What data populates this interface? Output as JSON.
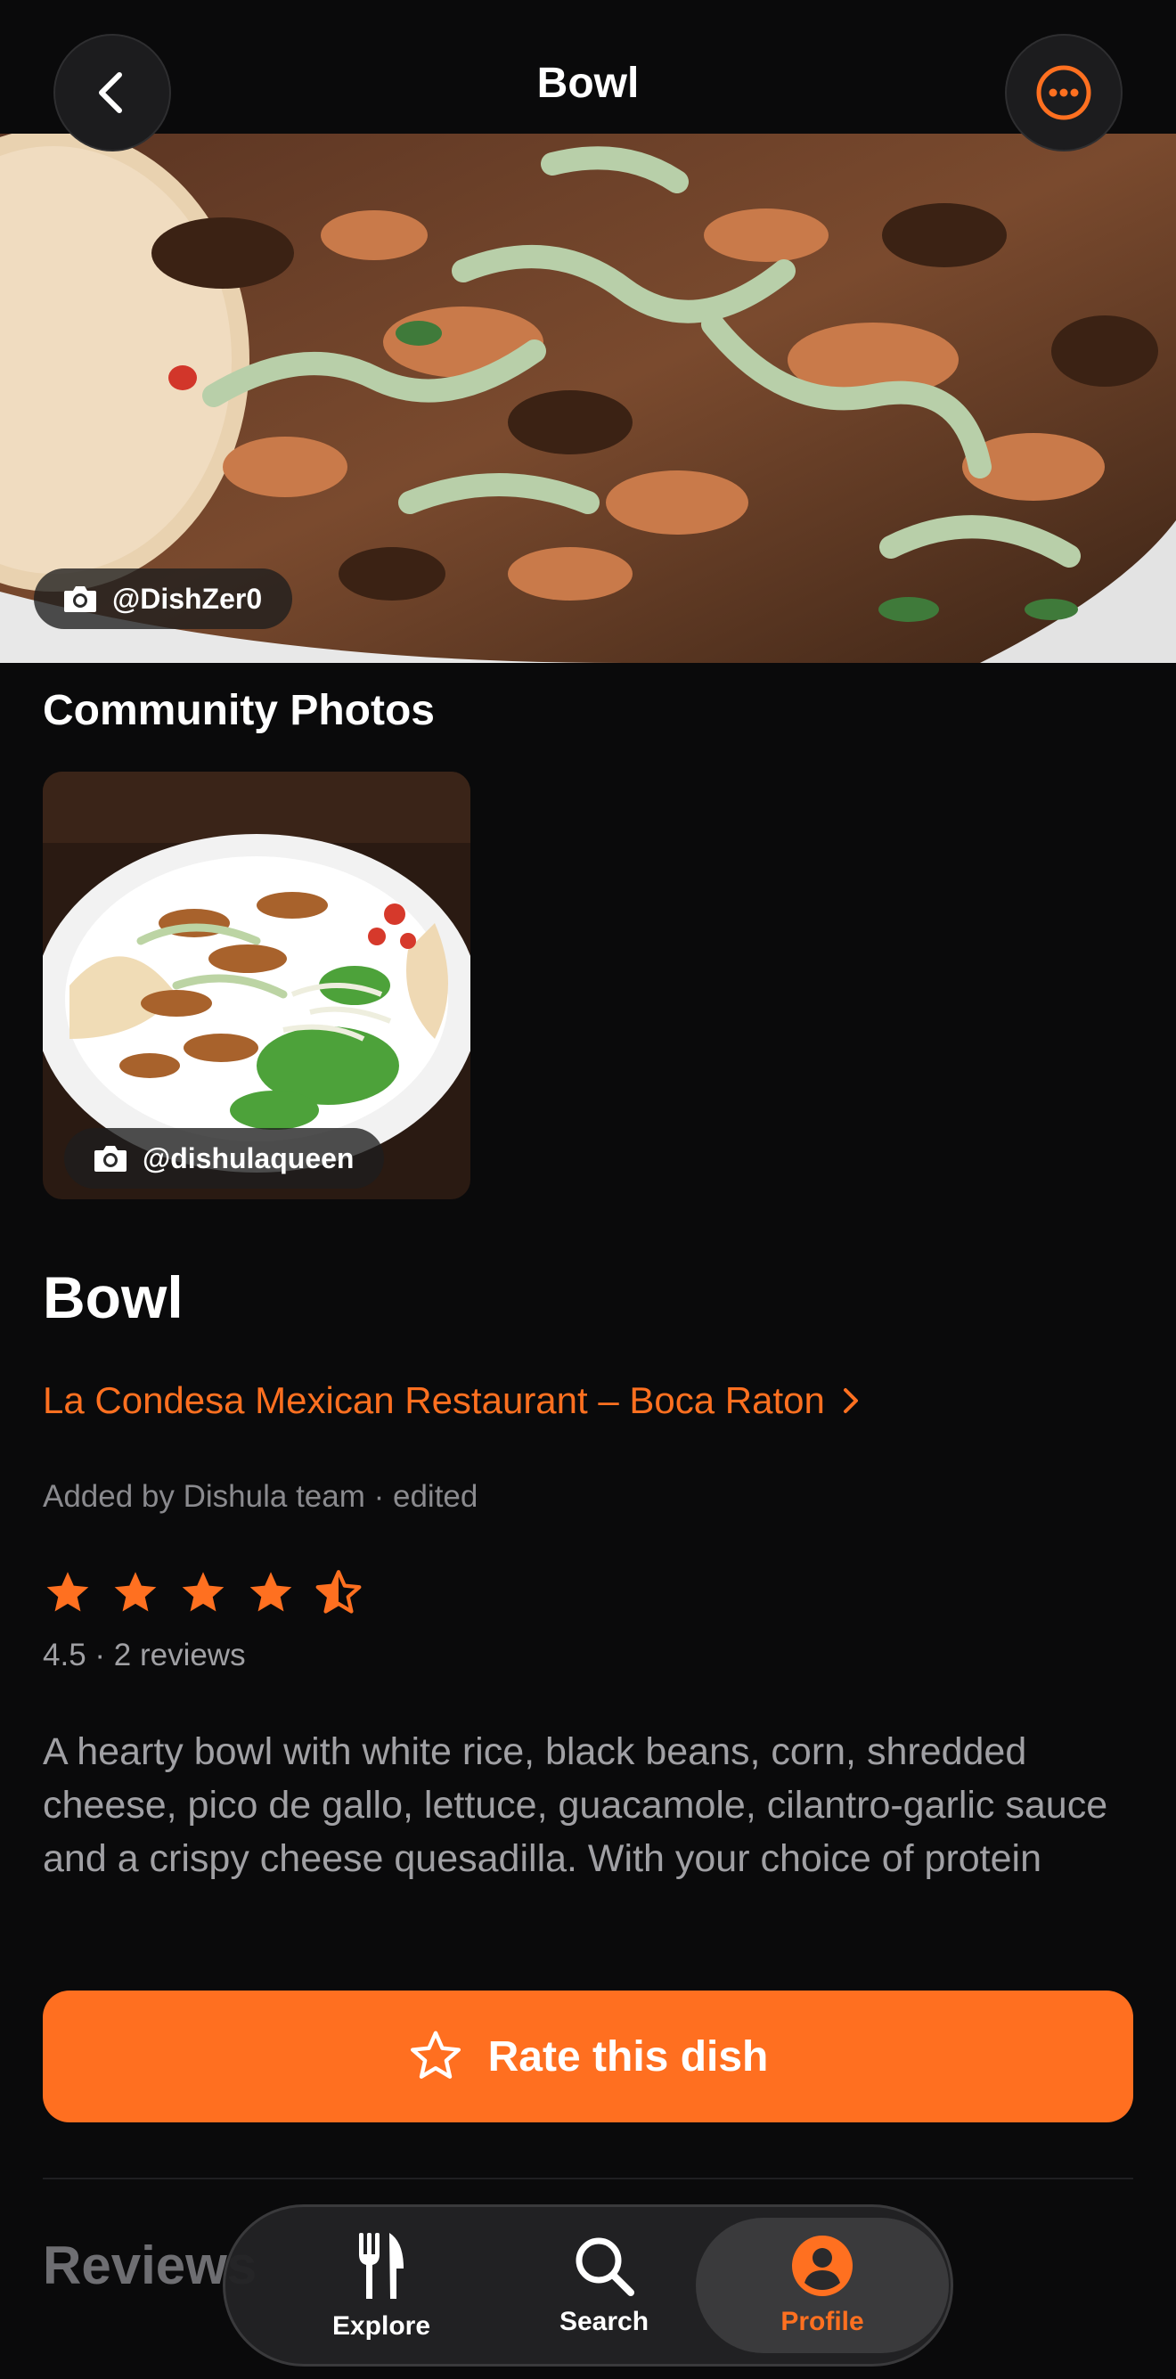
{
  "header": {
    "title": "Bowl",
    "back_icon": "chevron-left-icon",
    "more_icon": "ellipsis-circle-icon"
  },
  "hero_photo": {
    "credit": "@DishZer0"
  },
  "community": {
    "heading": "Community Photos",
    "photos": [
      {
        "credit": "@dishulaqueen"
      }
    ]
  },
  "dish": {
    "name": "Bowl",
    "restaurant": "La Condesa Mexican Restaurant – Boca Raton",
    "added_by": "Added by Dishula team · edited",
    "rating": 4.5,
    "rating_text": "4.5 · 2 reviews",
    "description": "A hearty bowl with white rice, black beans, corn, shredded cheese, pico de gallo, lettuce, guacamole, cilantro-garlic sauce and a crispy cheese quesadilla. With your choice of protein"
  },
  "actions": {
    "rate_label": "Rate this dish"
  },
  "reviews": {
    "heading": "Reviews"
  },
  "tabbar": {
    "items": [
      {
        "label": "Explore",
        "icon": "fork-knife-icon"
      },
      {
        "label": "Search",
        "icon": "magnifier-icon"
      },
      {
        "label": "Profile",
        "icon": "person-circle-icon"
      }
    ],
    "active": "Profile"
  },
  "colors": {
    "accent": "#ff7020",
    "button": "#ff6f20",
    "background": "#0a0a0b"
  }
}
